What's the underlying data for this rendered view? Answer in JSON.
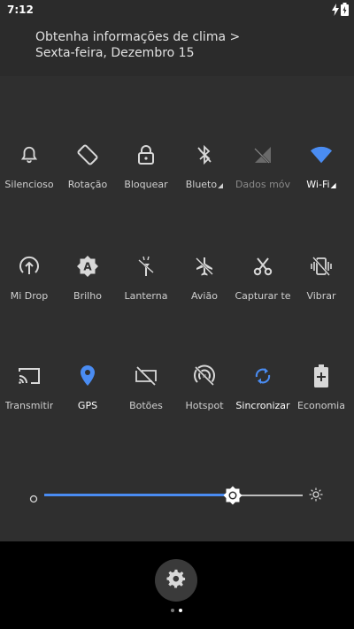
{
  "status": {
    "time": "7:12"
  },
  "header": {
    "weather_text": "Obtenha informações de clima >",
    "date_text": "Sexta-feira, Dezembro 15"
  },
  "tiles_row1": [
    {
      "label": "Silencioso",
      "icon": "bell-icon",
      "state": "off"
    },
    {
      "label": "Rotação",
      "icon": "rotation-icon",
      "state": "off"
    },
    {
      "label": "Bloquear",
      "icon": "lock-icon",
      "state": "off"
    },
    {
      "label": "Blueto",
      "icon": "bluetooth-off-icon",
      "state": "off"
    },
    {
      "label": "Dados móv",
      "icon": "mobile-data-off-icon",
      "state": "disabled"
    },
    {
      "label": "Wi-Fi",
      "icon": "wifi-icon",
      "state": "on"
    }
  ],
  "tiles_row2": [
    {
      "label": "Mi Drop",
      "icon": "mi-drop-icon",
      "state": "off"
    },
    {
      "label": "Brilho",
      "icon": "auto-brightness-icon",
      "state": "off"
    },
    {
      "label": "Lanterna",
      "icon": "flashlight-icon",
      "state": "off"
    },
    {
      "label": "Avião",
      "icon": "airplane-icon",
      "state": "off"
    },
    {
      "label": "Capturar te",
      "icon": "scissors-icon",
      "state": "off"
    },
    {
      "label": "Vibrar",
      "icon": "vibrate-icon",
      "state": "off"
    }
  ],
  "tiles_row3": [
    {
      "label": "Transmitir",
      "icon": "cast-icon",
      "state": "off"
    },
    {
      "label": "GPS",
      "icon": "location-icon",
      "state": "on"
    },
    {
      "label": "Botões",
      "icon": "buttons-off-icon",
      "state": "off"
    },
    {
      "label": "Hotspot",
      "icon": "hotspot-off-icon",
      "state": "off"
    },
    {
      "label": "Sincronizar",
      "icon": "sync-icon",
      "state": "on"
    },
    {
      "label": "Economia",
      "icon": "battery-saver-icon",
      "state": "off"
    }
  ],
  "brightness": {
    "level": 0.73
  },
  "pager": {
    "current": 2,
    "total": 2
  },
  "colors": {
    "accent": "#4a8cf2",
    "panel": "#2f2f2f",
    "header": "#2b2b2b"
  }
}
